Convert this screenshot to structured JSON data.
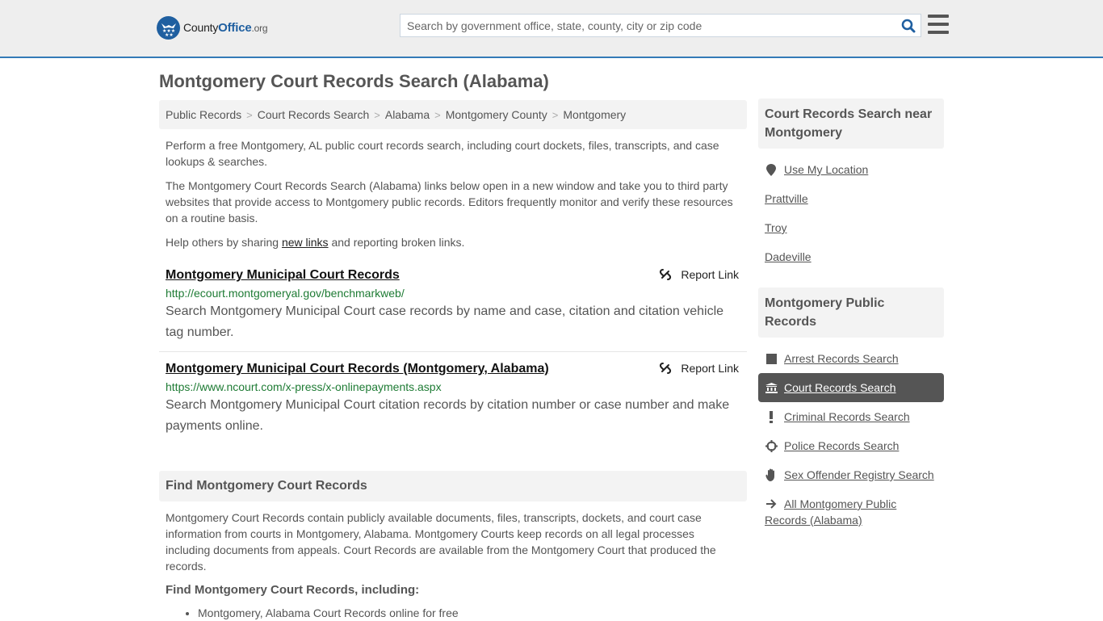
{
  "header": {
    "logo": {
      "name": "County",
      "office": "Office",
      "tld": ".org"
    },
    "search": {
      "placeholder": "Search by government office, state, county, city or zip code",
      "value": ""
    },
    "accent_color": "#337ab7"
  },
  "page": {
    "title": "Montgomery Court Records Search (Alabama)"
  },
  "breadcrumb": [
    {
      "label": "Public Records"
    },
    {
      "label": "Court Records Search"
    },
    {
      "label": "Alabama"
    },
    {
      "label": "Montgomery County"
    },
    {
      "label": "Montgomery"
    }
  ],
  "intro": {
    "p1": "Perform a free Montgomery, AL public court records search, including court dockets, files, transcripts, and case lookups & searches.",
    "p2": "The Montgomery Court Records Search (Alabama) links below open in a new window and take you to third party websites that provide access to Montgomery public records. Editors frequently monitor and verify these resources on a routine basis.",
    "p3_before": "Help others by sharing ",
    "p3_link": "new links",
    "p3_after": " and reporting broken links."
  },
  "results": [
    {
      "title": "Montgomery Municipal Court Records",
      "url": "http://ecourt.montgomeryal.gov/benchmarkweb/",
      "description": "Search Montgomery Municipal Court case records by name and case, citation and citation vehicle tag number.",
      "report_label": "Report Link"
    },
    {
      "title": "Montgomery Municipal Court Records (Montgomery, Alabama)",
      "url": "https://www.ncourt.com/x-press/x-onlinepayments.aspx",
      "description": "Search Montgomery Municipal Court citation records by citation number or case number and make payments online.",
      "report_label": "Report Link"
    }
  ],
  "find_section": {
    "heading": "Find Montgomery Court Records",
    "body": "Montgomery Court Records contain publicly available documents, files, transcripts, dockets, and court case information from courts in Montgomery, Alabama. Montgomery Courts keep records on all legal processes including documents from appeals. Court Records are available from the Montgomery Court that produced the records.",
    "subheading": "Find Montgomery Court Records, including:",
    "items": [
      "Montgomery, Alabama Court Records online for free"
    ]
  },
  "sidebar": {
    "near": {
      "heading": "Court Records Search near Montgomery",
      "use_location": "Use My Location",
      "cities": [
        "Prattville",
        "Troy",
        "Dadeville"
      ]
    },
    "public_records": {
      "heading": "Montgomery Public Records",
      "items": [
        {
          "label": "Arrest Records Search",
          "icon": "square-icon",
          "active": false
        },
        {
          "label": "Court Records Search",
          "icon": "courthouse-icon",
          "active": true
        },
        {
          "label": "Criminal Records Search",
          "icon": "exclamation-icon",
          "active": false
        },
        {
          "label": "Police Records Search",
          "icon": "crosshair-icon",
          "active": false
        },
        {
          "label": "Sex Offender Registry Search",
          "icon": "hand-icon",
          "active": false
        },
        {
          "label": "All Montgomery Public Records (Alabama)",
          "icon": "arrow-right-icon",
          "active": false
        }
      ]
    }
  }
}
